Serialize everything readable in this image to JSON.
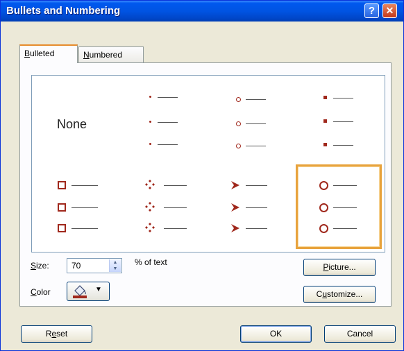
{
  "window": {
    "title": "Bullets and Numbering"
  },
  "titlebar": {
    "help_glyph": "?",
    "close_glyph": "✕"
  },
  "tabs": [
    {
      "pre": "",
      "key": "B",
      "post": "ulleted",
      "active": true
    },
    {
      "pre": "",
      "key": "N",
      "post": "umbered",
      "active": false
    }
  ],
  "gallery": {
    "none_label": "None",
    "selected_index": 7,
    "bullet_color": "#a0281c",
    "styles": [
      "none",
      "small-dot",
      "hollow-circle",
      "square",
      "hollow-square",
      "four-diamonds",
      "arrowhead",
      "large-hollow-circle"
    ]
  },
  "size": {
    "pre": "",
    "key": "S",
    "post": "ize:",
    "value": "70",
    "unit": "% of text"
  },
  "color": {
    "pre": "",
    "key": "C",
    "post": "olor",
    "swatch": "#a0281c"
  },
  "buttons": {
    "picture": {
      "pre": "",
      "key": "P",
      "post": "icture..."
    },
    "customize": {
      "pre": "C",
      "key": "u",
      "post": "stomize..."
    },
    "reset": {
      "pre": "R",
      "key": "e",
      "post": "set"
    },
    "ok": "OK",
    "cancel": "Cancel"
  }
}
